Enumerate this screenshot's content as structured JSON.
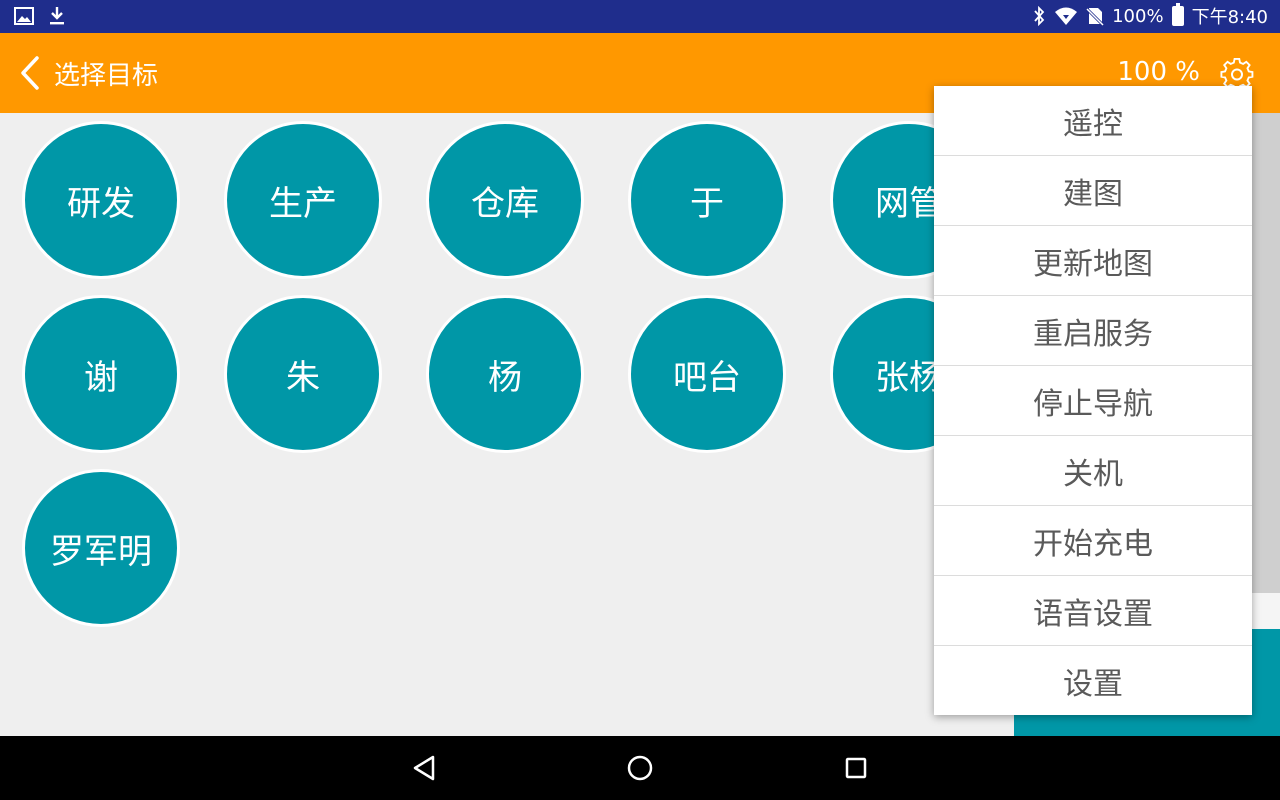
{
  "statusbar": {
    "battery_text": "100%",
    "battery_level": 1.0,
    "time": "下午8:40",
    "icons": [
      "image-icon",
      "download-icon",
      "bluetooth-icon",
      "wifi-icon",
      "no-sim-icon",
      "battery-icon"
    ]
  },
  "actionbar": {
    "back_icon": "chevron-left-icon",
    "title": "选择目标",
    "charge_percent": "100 %",
    "settings_icon": "gear-icon"
  },
  "targets": [
    {
      "label": "研发"
    },
    {
      "label": "生产"
    },
    {
      "label": "仓库"
    },
    {
      "label": "于"
    },
    {
      "label": "网管"
    },
    {
      "label": "谢"
    },
    {
      "label": "朱"
    },
    {
      "label": "杨"
    },
    {
      "label": "吧台"
    },
    {
      "label": "张杨"
    },
    {
      "label": "罗军明"
    }
  ],
  "menu": {
    "items": [
      {
        "label": "遥控"
      },
      {
        "label": "建图"
      },
      {
        "label": "更新地图"
      },
      {
        "label": "重启服务"
      },
      {
        "label": "停止导航"
      },
      {
        "label": "关机"
      },
      {
        "label": "开始充电"
      },
      {
        "label": "语音设置"
      },
      {
        "label": "设置"
      }
    ]
  },
  "navbar": {
    "icons": [
      "back-triangle-icon",
      "home-circle-icon",
      "recents-square-icon"
    ]
  },
  "colors": {
    "status_bar": "#1f2d8c",
    "action_bar": "#ff9800",
    "target_fill": "#0097a7",
    "background": "#efefef",
    "menu_text": "#5a5a5a"
  }
}
